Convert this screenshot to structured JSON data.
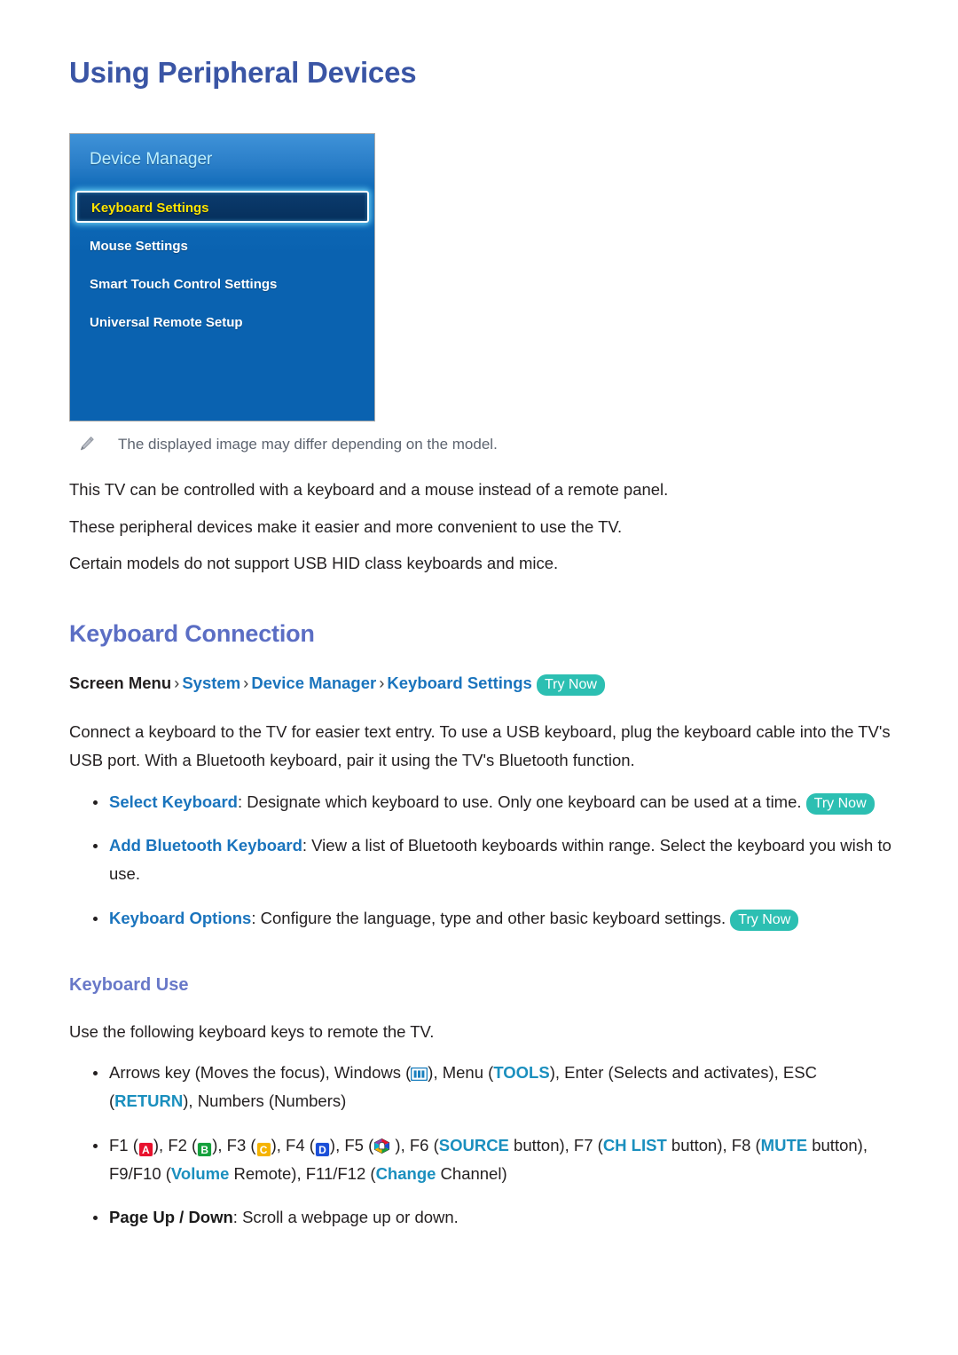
{
  "page": {
    "title": "Using Peripheral Devices"
  },
  "tv_panel": {
    "title": "Device Manager",
    "items": [
      {
        "label": "Keyboard Settings",
        "selected": true
      },
      {
        "label": "Mouse Settings",
        "selected": false
      },
      {
        "label": "Smart Touch Control Settings",
        "selected": false
      },
      {
        "label": "Universal Remote Setup",
        "selected": false
      }
    ],
    "colors": {
      "panel_blue": "#0a62b0",
      "header_blue": "#2a7ec8",
      "title_cyan": "#bdf0ff",
      "selected_text": "#ffe400",
      "selected_fill": "#06305c"
    }
  },
  "note": {
    "icon": "pencil-icon",
    "text": "The displayed image may differ depending on the model."
  },
  "intro": {
    "paragraphs": [
      "This TV can be controlled with a keyboard and a mouse instead of a remote panel.",
      "These peripheral devices make it easier and more convenient to use the TV.",
      "Certain models do not support USB HID class keyboards and mice."
    ]
  },
  "keyboard_connection": {
    "heading": "Keyboard Connection",
    "breadcrumb": {
      "root": "Screen Menu",
      "separator": "›",
      "crumbs": [
        "System",
        "Device Manager",
        "Keyboard Settings"
      ],
      "badge": "Try Now"
    },
    "paragraph": "Connect a keyboard to the TV for easier text entry. To use a USB keyboard, plug the keyboard cable into the TV's USB port. With a Bluetooth keyboard, pair it using the TV's Bluetooth function.",
    "bullets": [
      {
        "term": "Select Keyboard",
        "text": ": Designate which keyboard to use. Only one keyboard can be used at a time.",
        "badge": "Try Now"
      },
      {
        "term": "Add Bluetooth Keyboard",
        "text": ": View a list of Bluetooth keyboards within range. Select the keyboard you wish to use.",
        "badge": ""
      },
      {
        "term": "Keyboard Options",
        "text": ": Configure the language, type and other basic keyboard settings.",
        "badge": "Try Now"
      }
    ]
  },
  "keyboard_use": {
    "heading": "Keyboard Use",
    "intro": "Use the following keyboard keys to remote the TV.",
    "arrows_bullet": {
      "part1": "Arrows key (Moves the focus), Windows (",
      "windows_icon": "windows-key-icon",
      "part2": "), Menu (",
      "tools": "TOOLS",
      "part3": "), Enter (Selects and activates), ESC (",
      "return": "RETURN",
      "part4": "), Numbers (Numbers)"
    },
    "fkeys_bullet": {
      "f1": "F1 (",
      "chip_a": "A",
      "f2": "), F2 (",
      "chip_b": "B",
      "f3": "), F3 (",
      "chip_c": "C",
      "f4": "), F4 (",
      "chip_d": "D",
      "f5": "), F5 (",
      "hub_icon": "smart-hub-icon",
      "f6": " ), F6 (",
      "source": "SOURCE",
      "f7": " button), F7 (",
      "chlist": "CH LIST",
      "f8": " button), F8 (",
      "mute": "MUTE",
      "f9": " button), F9/F10 (",
      "volume": "Volume",
      "f11": " Remote), F11/F12 (",
      "change": "Change",
      "f12": " Channel)"
    },
    "pageupdown_bullet": {
      "term": "Page Up / Down",
      "text": ": Scroll a webpage up or down."
    }
  },
  "theme": {
    "h1_color": "#3a55a5",
    "h2_color": "#5b6ec4",
    "h3_color": "#6878c8",
    "link_blue": "#1a74bd",
    "keyword_teal": "#1a8fbe",
    "badge_teal": "#2cbfb2",
    "body_text": "#231f20",
    "note_text": "#5d6470"
  }
}
